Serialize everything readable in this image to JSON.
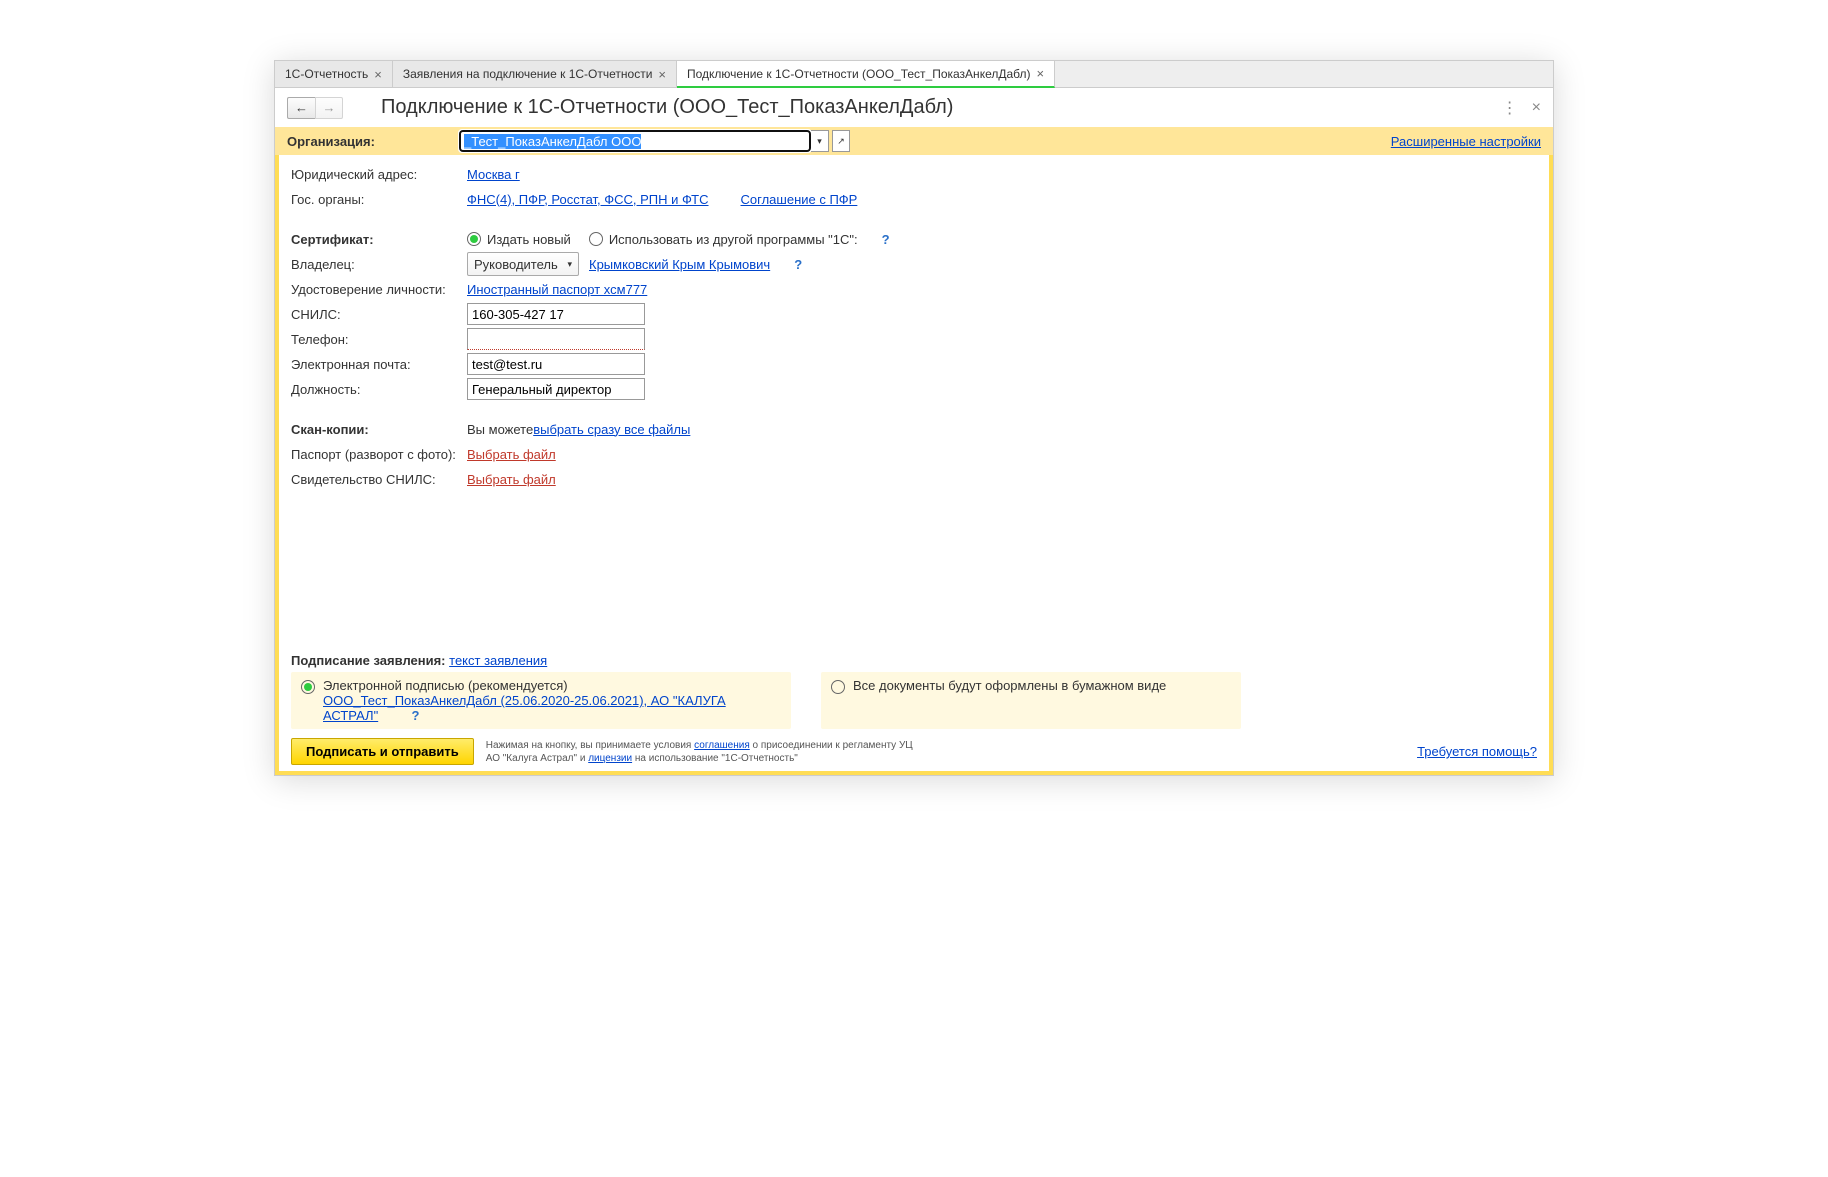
{
  "tabs": [
    {
      "label": "1С-Отчетность"
    },
    {
      "label": "Заявления на подключение к 1С-Отчетности"
    },
    {
      "label": "Подключение к 1С-Отчетности (ООО_Тест_ПоказАнкелДабл)"
    }
  ],
  "page_title": "Подключение к 1С-Отчетности (ООО_Тест_ПоказАнкелДабл)",
  "org": {
    "label": "Организация:",
    "value": "_Тест_ПоказАнкелДабл ООО",
    "advanced_link": "Расширенные настройки"
  },
  "address": {
    "label": "Юридический адрес:",
    "value": "Москва г"
  },
  "gos": {
    "label": "Гос. органы:",
    "value": "ФНС(4), ПФР, Росстат, ФСС, РПН и ФТС",
    "agreement": "Соглашение с ПФР"
  },
  "cert": {
    "label": "Сертификат:",
    "opt_new": "Издать новый",
    "opt_other": "Использовать из другой программы \"1С\":"
  },
  "owner": {
    "label": "Владелец:",
    "role": "Руководитель",
    "name": "Крымковский Крым Крымович"
  },
  "id_doc": {
    "label": "Удостоверение личности:",
    "value": "Иностранный паспорт хсм777"
  },
  "snils": {
    "label": "СНИЛС:",
    "value": "160-305-427 17"
  },
  "phone": {
    "label": "Телефон:",
    "value": ""
  },
  "email": {
    "label": "Электронная почта:",
    "value": "test@test.ru"
  },
  "position": {
    "label": "Должность:",
    "value": "Генеральный директор"
  },
  "scans": {
    "title": "Скан-копии:",
    "hint_prefix": "Вы можете ",
    "hint_link": "выбрать сразу все файлы",
    "passport_label": "Паспорт (разворот с фото):",
    "passport_action": "Выбрать файл",
    "snils_label": "Свидетельство СНИЛС:",
    "snils_action": "Выбрать файл"
  },
  "signing": {
    "title_prefix": "Подписание заявления: ",
    "title_link": "текст заявления",
    "opt_electronic": "Электронной подписью (рекомендуется)",
    "electronic_detail": "ООО_Тест_ПоказАнкелДабл (25.06.2020-25.06.2021), АО \"КАЛУГА АСТРАЛ\"",
    "opt_paper": "Все документы будут оформлены в бумажном виде"
  },
  "footer": {
    "submit": "Подписать и отправить",
    "fine1_a": "Нажимая на кнопку, вы принимаете условия ",
    "fine1_link": "соглашения",
    "fine1_b": " о присоединении к регламенту УЦ",
    "fine2_a": "АО \"Калуга Астрал\" и ",
    "fine2_link": "лицензии",
    "fine2_b": " на использование \"1С-Отчетность\"",
    "help": "Требуется помощь?"
  },
  "help_icon": "?"
}
